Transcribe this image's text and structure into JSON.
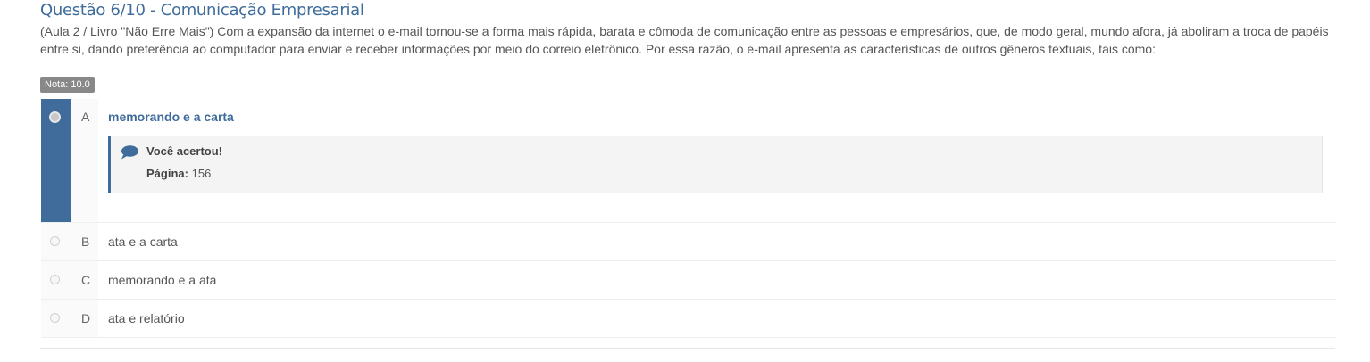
{
  "question": {
    "title": "Questão 6/10 - Comunicação Empresarial",
    "text": "(Aula 2 / Livro \"Não Erre Mais\") Com a expansão da internet o e-mail tornou-se a forma mais rápida, barata e cômoda de comunicação entre as pessoas e empresários, que, de modo geral, mundo afora, já aboliram a troca de papéis entre si, dando preferência ao computador para enviar e receber informações por meio do correio eletrônico. Por essa razão, o e-mail apresenta as características de outros gêneros textuais, tais como:",
    "grade": "Nota: 10.0"
  },
  "options": [
    {
      "letter": "A",
      "text": "memorando e a carta",
      "selected": true
    },
    {
      "letter": "B",
      "text": "ata e a carta",
      "selected": false
    },
    {
      "letter": "C",
      "text": "memorando e a ata",
      "selected": false
    },
    {
      "letter": "D",
      "text": "ata e relatório",
      "selected": false
    }
  ],
  "feedback": {
    "icon": "comment-icon",
    "title": "Você acertou!",
    "page_label": "Página:",
    "page_value": "156"
  },
  "colors": {
    "accent": "#3f6c9b",
    "badge": "#888888",
    "feedback_bg": "#f4f4f4"
  }
}
